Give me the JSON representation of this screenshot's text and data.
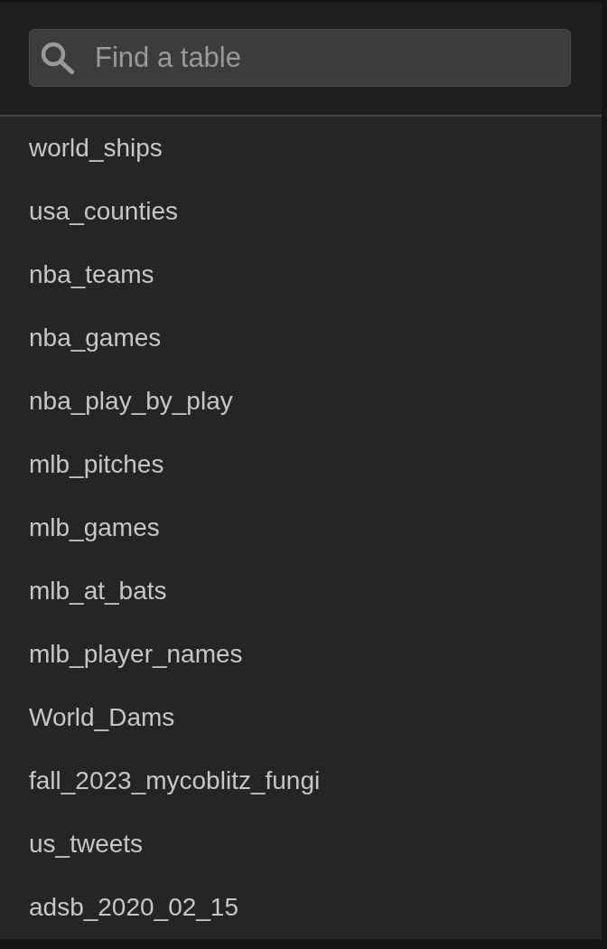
{
  "search": {
    "placeholder": "Find a table"
  },
  "tables": [
    "world_ships",
    "usa_counties",
    "nba_teams",
    "nba_games",
    "nba_play_by_play",
    "mlb_pitches",
    "mlb_games",
    "mlb_at_bats",
    "mlb_player_names",
    "World_Dams",
    "fall_2023_mycoblitz_fungi",
    "us_tweets",
    "adsb_2020_02_15"
  ]
}
